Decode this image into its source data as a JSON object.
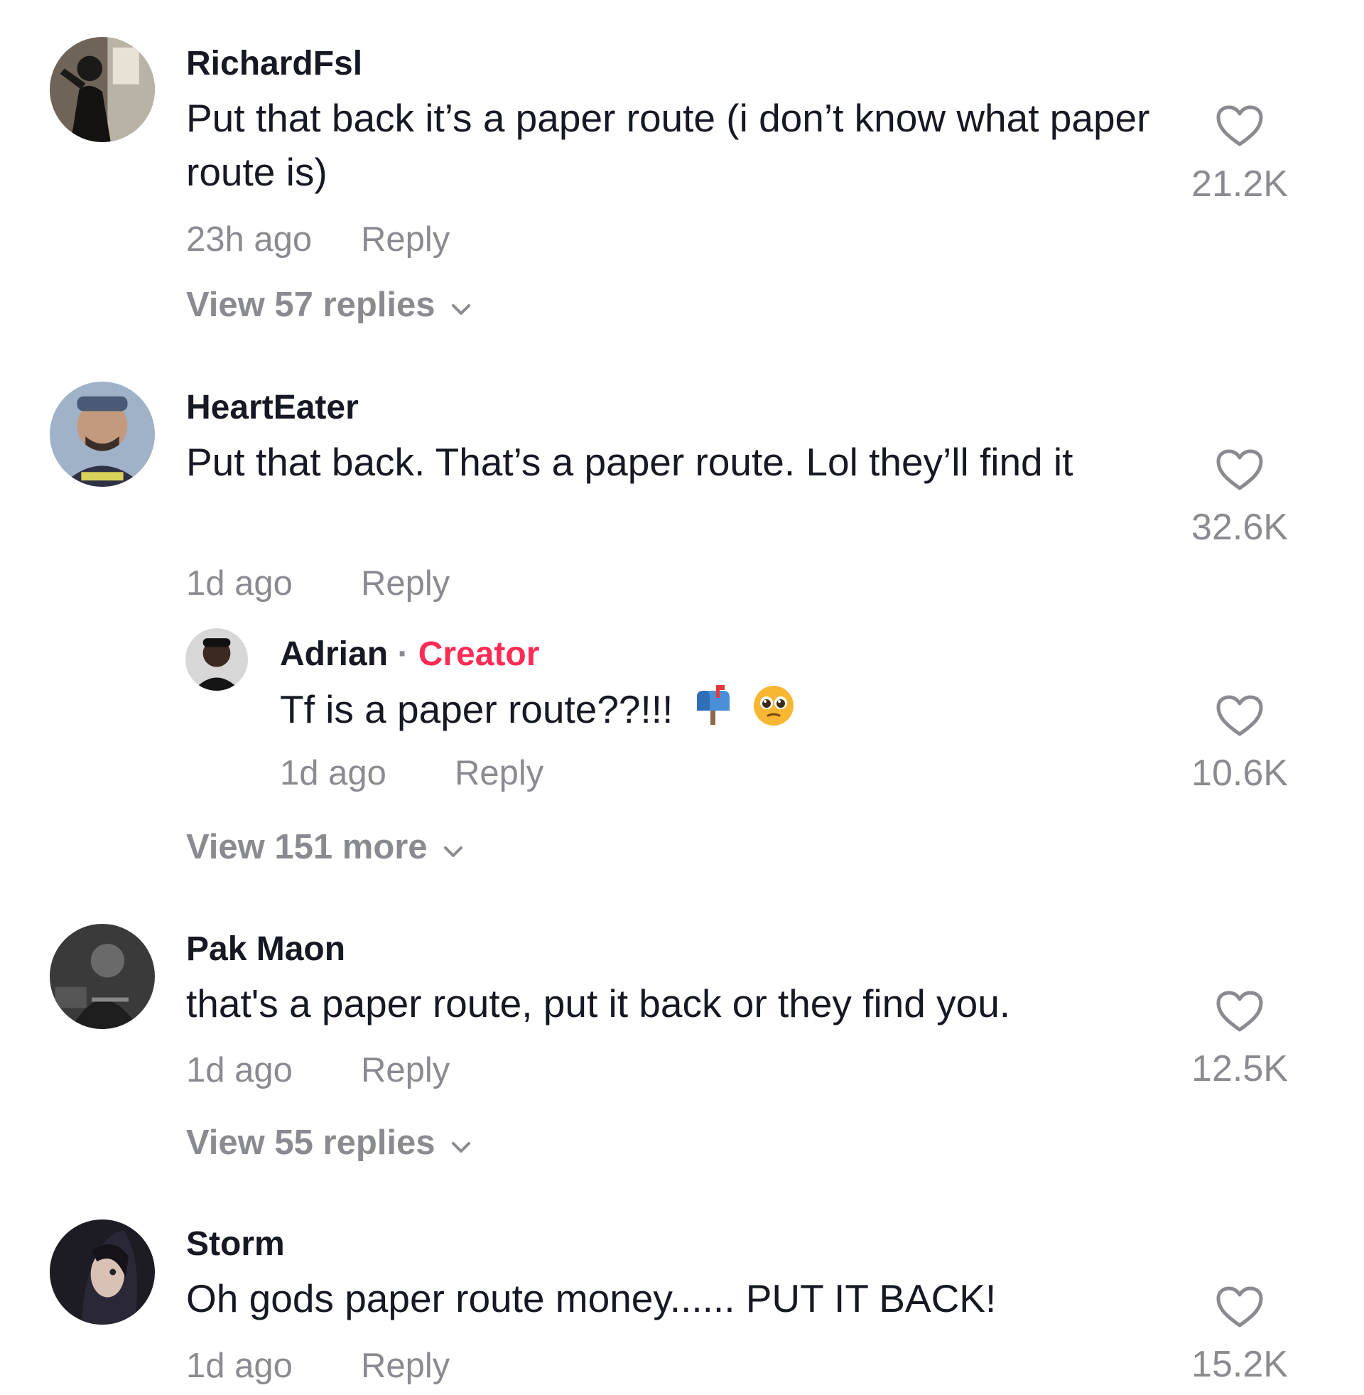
{
  "comments": [
    {
      "username": "RichardFsl",
      "text": "Put that back it’s a paper route (i don’t know what paper route is)",
      "time": "23h ago",
      "reply_label": "Reply",
      "likes": "21.2K",
      "view_replies": "View 57 replies",
      "avatar": "avatar-richardfsl"
    },
    {
      "username": "HeartEater",
      "text": "Put that back. That’s a paper route. Lol they’ll find it",
      "time": "1d ago",
      "reply_label": "Reply",
      "likes": "32.6K",
      "avatar": "avatar-hearteater",
      "reply": {
        "username": "Adrian",
        "separator": "·",
        "badge": "Creator",
        "text": "Tf is a paper route??!!!",
        "emojis": [
          "mailbox-emoji",
          "pleading-face-emoji"
        ],
        "time": "1d ago",
        "reply_label": "Reply",
        "likes": "10.6K"
      },
      "view_replies": "View 151 more"
    },
    {
      "username": "Pak Maon",
      "text": "that's a paper route, put it back or they find you.",
      "time": "1d ago",
      "reply_label": "Reply",
      "likes": "12.5K",
      "view_replies": "View 55 replies",
      "avatar": "avatar-pakmaon"
    },
    {
      "username": "Storm",
      "text": "Oh gods paper route money...... PUT IT BACK!",
      "time": "1d ago",
      "reply_label": "Reply",
      "likes": "15.2K",
      "avatar": "avatar-storm"
    }
  ],
  "icons": {
    "like": "heart-outline-icon",
    "expand": "chevron-down-icon"
  },
  "colors": {
    "text": "#161823",
    "muted": "#8a8b91",
    "creator": "#fe2c55"
  }
}
